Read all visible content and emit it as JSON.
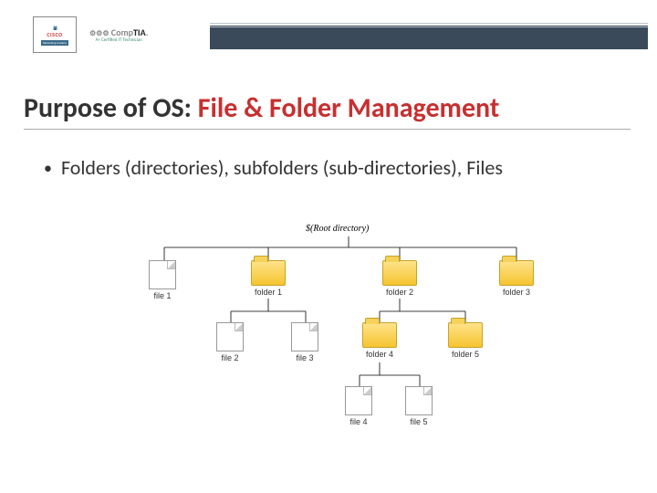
{
  "header": {
    "cisco_bars": "ılıılı",
    "cisco_text": "CISCO",
    "cisco_sub": "Networking Academy",
    "comptia_cog": "⚙⚙⚙",
    "comptia_grey": "Comp",
    "comptia_bold": "TIA",
    "comptia_dot": ".",
    "comptia_sub": "A+ Certified IT Technician"
  },
  "title": {
    "plain": "Purpose of OS: ",
    "accent": "File & Folder Management"
  },
  "bullet": {
    "text": "Folders (directories), subfolders (sub-directories), Files"
  },
  "tree": {
    "root": "$(Root directory)",
    "n1": "file 1",
    "n2": "folder 1",
    "n3": "folder 2",
    "n4": "folder 3",
    "n5": "file 2",
    "n6": "file 3",
    "n7": "folder 4",
    "n8": "folder 5",
    "n9": "file 4",
    "n10": "file 5"
  }
}
